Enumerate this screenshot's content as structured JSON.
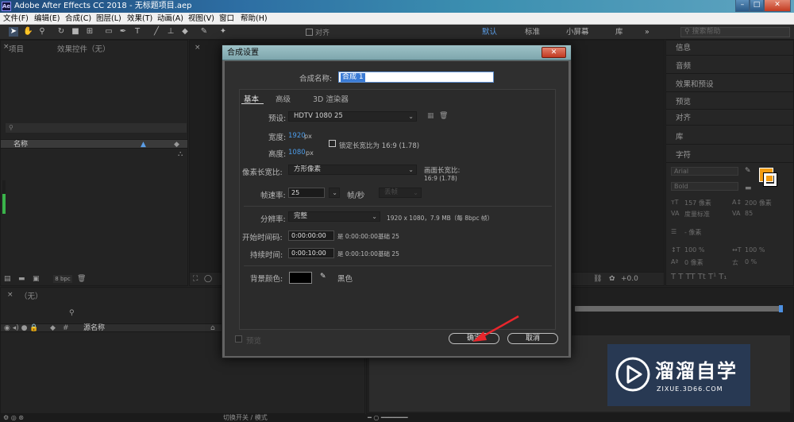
{
  "window": {
    "title": "Adobe After Effects CC 2018 - 无标题项目.aep",
    "app_icon": "Ae"
  },
  "menu": [
    "文件(F)",
    "编辑(E)",
    "合成(C)",
    "图层(L)",
    "效果(T)",
    "动画(A)",
    "视图(V)",
    "窗口",
    "帮助(H)"
  ],
  "toolbar": {
    "snap_label": "对齐",
    "workspaces": [
      "默认",
      "标准",
      "小屏幕",
      "库"
    ],
    "search_placeholder": "搜索帮助"
  },
  "project_panel": {
    "tab_project": "项目",
    "tab_effects": "效果控件（无）",
    "column_name": "名称",
    "bpc": "8 bpc"
  },
  "right_panel": {
    "items": [
      "信息",
      "音频",
      "效果和预设",
      "预览",
      "对齐",
      "库"
    ],
    "character_title": "字符",
    "font_name": "Arial",
    "font_style": "Bold",
    "font_size": "157 像素",
    "leading": "200 像素",
    "kerning": "度量标准",
    "tracking": "85",
    "stroke_width": "- 像素",
    "vscale": "100 %",
    "hscale": "100 %",
    "baseline": "0 像素",
    "tsume": "0 %",
    "colors": {
      "fill": "#f39c12",
      "stroke": "#ffffff"
    }
  },
  "comp_footer": {
    "exposure": "+0.0"
  },
  "timeline": {
    "tab": "（无）",
    "column_source": "源名称"
  },
  "statusbar": {
    "text": "切换开关 / 模式"
  },
  "dialog": {
    "title": "合成设置",
    "name_label": "合成名称:",
    "name_value": "合成 1",
    "tabs": [
      "基本",
      "高级",
      "3D 渲染器"
    ],
    "preset_label": "预设:",
    "preset_value": "HDTV 1080 25",
    "width_label": "宽度:",
    "width_value": "1920",
    "height_label": "高度:",
    "height_value": "1080",
    "px": "px",
    "lock_label": "锁定长宽比为 16:9 (1.78)",
    "pixel_aspect_label": "像素长宽比:",
    "pixel_aspect_value": "方形像素",
    "frame_aspect_label": "画面长宽比:",
    "frame_aspect_value": "16:9 (1.78)",
    "fps_label": "帧速率:",
    "fps_value": "25",
    "fps_unit": "帧/秒",
    "fps_drop": "丢帧",
    "resolution_label": "分辨率:",
    "resolution_value": "完整",
    "resolution_info": "1920 x 1080，7.9 MB（每 8bpc 帧）",
    "start_tc_label": "开始时间码:",
    "start_tc_value": "0:00:00:00",
    "start_tc_info": "是 0:00:00:00",
    "start_tc_base": "基础 25",
    "duration_label": "持续时间:",
    "duration_value": "0:00:10:00",
    "duration_info": "是 0:00:10:00",
    "duration_base": "基础 25",
    "bg_label": "背景颜色:",
    "bg_color_name": "黑色",
    "bg_color": "#000000",
    "preview_label": "预览",
    "ok_label": "确定",
    "cancel_label": "取消"
  },
  "watermark": {
    "title": "溜溜自学",
    "subtitle": "ZIXUE.3D66.COM"
  }
}
